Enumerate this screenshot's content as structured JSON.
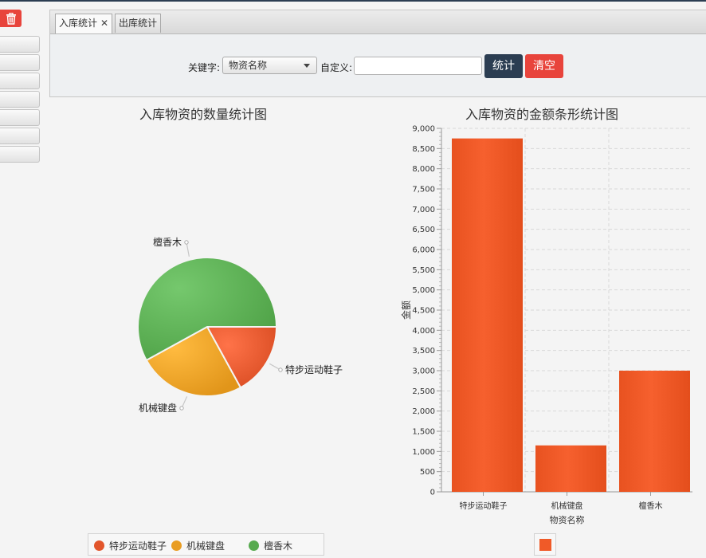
{
  "toolbar": {
    "trash_icon": "trash-icon"
  },
  "tabs": [
    {
      "label": "入库统计",
      "active": true,
      "closable": true
    },
    {
      "label": "出库统计",
      "active": false
    }
  ],
  "search": {
    "keyword_label": "关键字:",
    "keyword_selected": "物资名称",
    "custom_label": "自定义:",
    "custom_value": "",
    "stat_button": "统计",
    "clear_button": "清空"
  },
  "colors": {
    "dark": "#2b3d52",
    "red": "#e8443c",
    "bar": "#f05a28",
    "pie1": "#e2552b",
    "pie2": "#e99d22",
    "pie3": "#57aa4f"
  },
  "chart_data": [
    {
      "type": "pie",
      "title": "入库物资的数量统计图",
      "slices": [
        {
          "label": "特步运动鞋子",
          "value": 17,
          "color": "#e2552b"
        },
        {
          "label": "机械键盘",
          "value": 25,
          "color": "#e99d22"
        },
        {
          "label": "檀香木",
          "value": 58,
          "color": "#57aa4f"
        }
      ],
      "legend": [
        "特步运动鞋子",
        "机械键盘",
        "檀香木"
      ]
    },
    {
      "type": "bar",
      "title": "入库物资的金额条形统计图",
      "categories": [
        "特步运动鞋子",
        "机械键盘",
        "檀香木"
      ],
      "values": [
        8750,
        1150,
        3000
      ],
      "xlabel": "物资名称",
      "ylabel": "金额",
      "ylim": [
        0,
        9000
      ],
      "yticks": [
        "0",
        "500",
        "1,000",
        "1,500",
        "2,000",
        "2,500",
        "3,000",
        "3,500",
        "4,000",
        "4,500",
        "5,000",
        "5,500",
        "6,000",
        "6,500",
        "7,000",
        "7,500",
        "8,000",
        "8,500",
        "9,000"
      ],
      "grid": true,
      "color": "#f05a28"
    }
  ]
}
